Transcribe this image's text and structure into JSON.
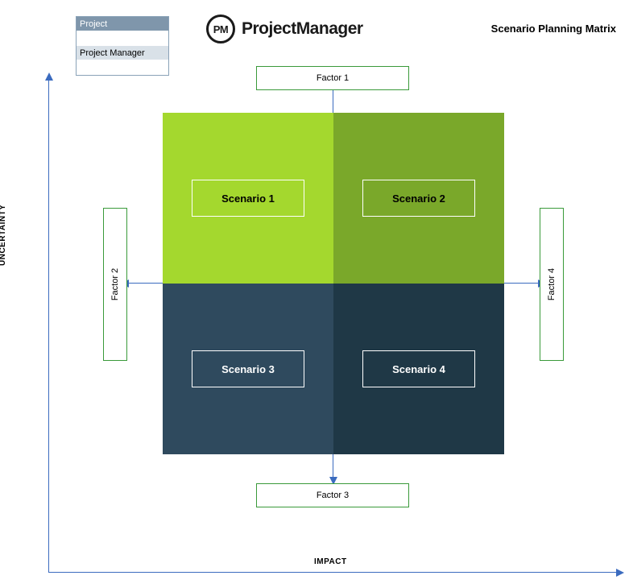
{
  "legend": {
    "row1": "Project",
    "row2": "",
    "row3": "Project Manager",
    "row4": ""
  },
  "brand": {
    "icon_text": "PM",
    "name": "ProjectManager"
  },
  "title": "Scenario Planning Matrix",
  "axes": {
    "y_label": "UNCERTAINTY",
    "x_label": "IMPACT"
  },
  "factors": {
    "top": "Factor 1",
    "left": "Factor 2",
    "bottom": "Factor 3",
    "right": "Factor 4"
  },
  "scenarios": {
    "q1": "Scenario 1",
    "q2": "Scenario 2",
    "q3": "Scenario 3",
    "q4": "Scenario 4"
  },
  "chart_data": {
    "type": "table",
    "title": "Scenario Planning Matrix",
    "xlabel": "IMPACT",
    "ylabel": "UNCERTAINTY",
    "factors_axis_vertical": [
      "Factor 1",
      "Factor 3"
    ],
    "factors_axis_horizontal": [
      "Factor 2",
      "Factor 4"
    ],
    "quadrants": [
      {
        "position": "top-left",
        "uncertainty": "high",
        "impact": "low",
        "label": "Scenario 1",
        "color": "#a4d82e"
      },
      {
        "position": "top-right",
        "uncertainty": "high",
        "impact": "high",
        "label": "Scenario 2",
        "color": "#7aa82a"
      },
      {
        "position": "bottom-left",
        "uncertainty": "low",
        "impact": "low",
        "label": "Scenario 3",
        "color": "#2f4a5e"
      },
      {
        "position": "bottom-right",
        "uncertainty": "low",
        "impact": "high",
        "label": "Scenario 4",
        "color": "#1f3846"
      }
    ]
  }
}
